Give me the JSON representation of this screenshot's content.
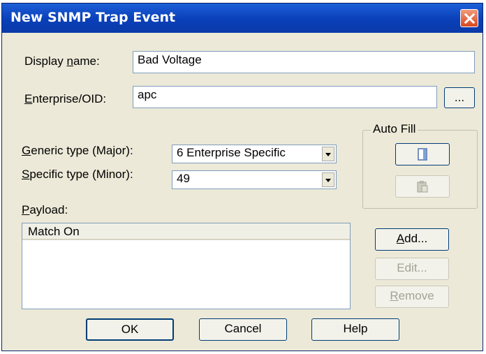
{
  "dialog": {
    "title": "New SNMP Trap Event"
  },
  "icons": {
    "close": "close-icon",
    "autofill_copy": "document-icon",
    "autofill_paste": "clipboard-icon"
  },
  "display_name": {
    "label_pre": "Display ",
    "label_u": "n",
    "label_post": "ame:",
    "value": "Bad Voltage"
  },
  "enterprise": {
    "label_u": "E",
    "label_post": "nterprise/OID:",
    "value": "apc",
    "browse_label": "..."
  },
  "generic_type": {
    "label_u": "G",
    "label_post": "eneric type (Major):",
    "value": "6 Enterprise Specific"
  },
  "specific_type": {
    "label_u": "S",
    "label_post": "pecific type (Minor):",
    "value": "49"
  },
  "auto_fill": {
    "title": "Auto Fill"
  },
  "payload": {
    "label_u": "P",
    "label_post": "ayload:",
    "column_header": "Match On"
  },
  "buttons": {
    "add_u": "A",
    "add_post": "dd...",
    "edit": "Edit...",
    "remove_u": "R",
    "remove_post": "emove",
    "ok": "OK",
    "cancel": "Cancel",
    "help": "Help"
  },
  "colors": {
    "titlebar": "#0a3fb8",
    "dialog_bg": "#ece9d8",
    "close": "#d8471f"
  }
}
